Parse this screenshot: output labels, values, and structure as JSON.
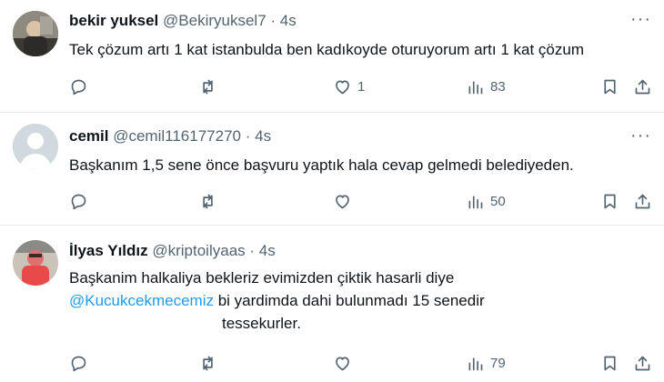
{
  "tweets": [
    {
      "name": "bekir yuksel",
      "handle": "@Bekiryuksel7",
      "dot": "·",
      "time": "4s",
      "lines": [
        "Tek çözum artı 1 kat istanbulda ben kadıkoyde oturuyorum artı 1 kat çözum"
      ],
      "replies": "",
      "retweets": "",
      "likes": "1",
      "views": "83"
    },
    {
      "name": "cemil",
      "handle": "@cemil116177270",
      "dot": "·",
      "time": "4s",
      "lines": [
        "Başkanım 1,5 sene önce başvuru yaptık hala  cevap gelmedi  belediyeden."
      ],
      "replies": "",
      "retweets": "",
      "likes": "",
      "views": "50"
    },
    {
      "name": "İlyas Yıldız",
      "handle": "@kriptoilyaas",
      "dot": "·",
      "time": "4s",
      "line1": "Başkanim halkaliya bekleriz evimizden çiktik hasarli diye",
      "mention": "@Kucukcekmecemiz",
      "line2_rest": " bi yardimda dahi bulunmadı 15 senedir",
      "line3": "tessekurler.",
      "replies": "",
      "retweets": "",
      "likes": "",
      "views": "79"
    }
  ],
  "more_label": "···",
  "colors": {
    "secondary": "#536471",
    "link": "#1d9bf0",
    "divider": "#e6e9ec"
  },
  "icons": [
    "reply-icon",
    "retweet-icon",
    "like-icon",
    "views-icon",
    "bookmark-icon",
    "share-icon",
    "more-icon"
  ]
}
